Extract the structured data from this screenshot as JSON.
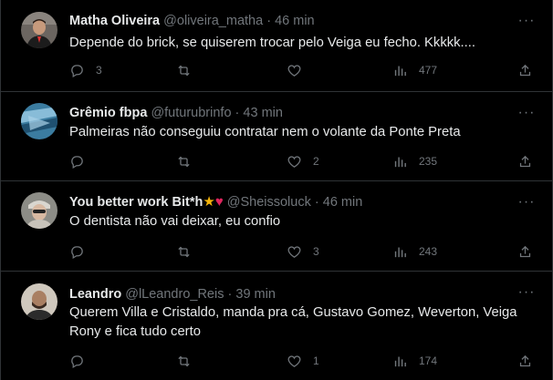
{
  "tweets": [
    {
      "name": "Matha Oliveira",
      "handle": "@oliveira_matha",
      "separator": "·",
      "time": "46 min",
      "text": "Depende do brick, se quiserem trocar pelo Veiga eu fecho. Kkkkk....",
      "replies": "3",
      "retweets": "",
      "likes": "",
      "views": "477"
    },
    {
      "name": "Grêmio fbpa",
      "handle": "@futurubrinfo",
      "separator": "·",
      "time": "43 min",
      "text": "Palmeiras não conseguiu contratar nem o volante da Ponte Preta",
      "replies": "",
      "retweets": "",
      "likes": "2",
      "views": "235"
    },
    {
      "name": "You better work Bit*h",
      "name_emoji_1": "★",
      "name_emoji_2": "♥",
      "handle": "@Sheissoluck",
      "separator": "·",
      "time": "46 min",
      "text": "O dentista não vai deixar, eu confio",
      "replies": "",
      "retweets": "",
      "likes": "3",
      "views": "243"
    },
    {
      "name": "Leandro",
      "handle": "@lLeandro_Reis",
      "separator": "·",
      "time": "39 min",
      "text": "Querem Villa e Cristaldo, manda pra cá, Gustavo Gomez, Weverton, Veiga Rony e fica tudo certo",
      "replies": "",
      "retweets": "",
      "likes": "1",
      "views": "174"
    }
  ],
  "more_glyph": "···",
  "colors": {
    "background": "#000000",
    "text": "#e7e9ea",
    "muted": "#71767b",
    "border": "#2f3336"
  }
}
